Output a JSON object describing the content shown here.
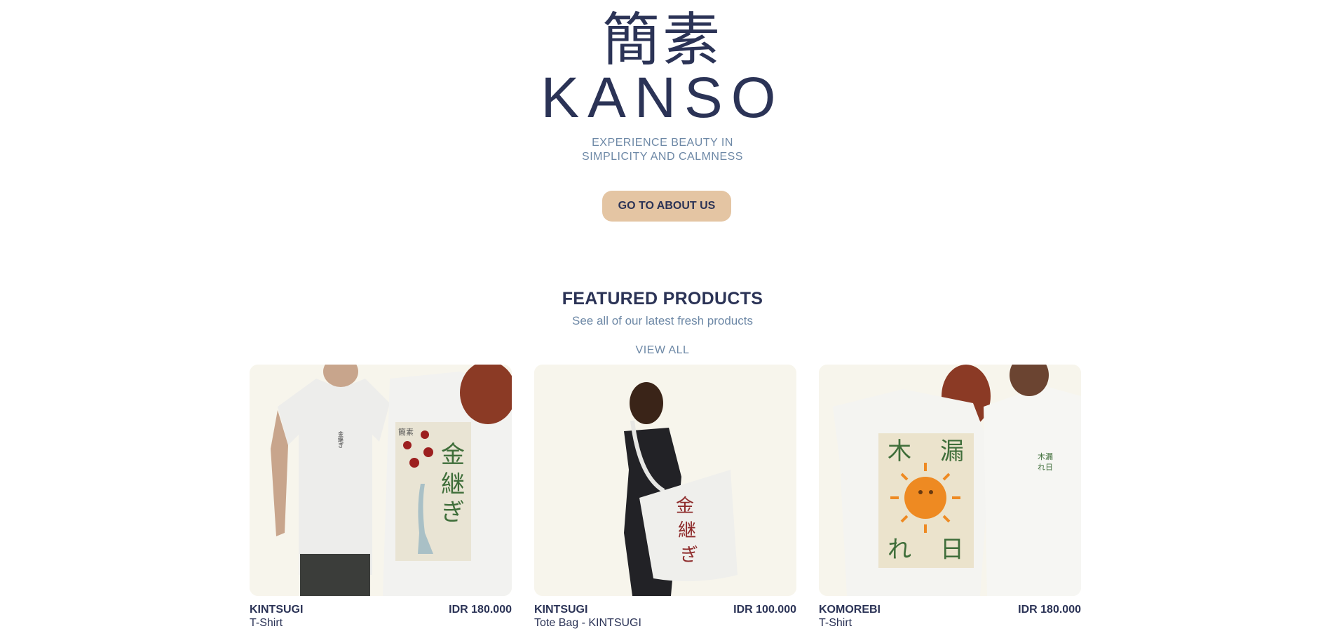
{
  "hero": {
    "logo_kanji": "簡素",
    "logo_latin": "KANSO",
    "tagline_line1": "EXPERIENCE BEAUTY IN",
    "tagline_line2": "SIMPLICITY AND CALMNESS",
    "cta_label": "GO TO ABOUT US"
  },
  "featured": {
    "title": "FEATURED PRODUCTS",
    "subtitle": "See all of our latest fresh products",
    "view_all": "VIEW ALL"
  },
  "products": [
    {
      "name": "KINTSUGI",
      "price": "IDR 180.000",
      "type": "T-Shirt",
      "image_icon": "kintsugi-tshirt-photo",
      "art_text": "金継ぎ"
    },
    {
      "name": "KINTSUGI",
      "price": "IDR 100.000",
      "type": "Tote Bag - KINTSUGI",
      "image_icon": "kintsugi-tote-bag-photo",
      "art_text": "金継ぎ"
    },
    {
      "name": "KOMOREBI",
      "price": "IDR 180.000",
      "type": "T-Shirt",
      "image_icon": "komorebi-tshirt-photo",
      "art_text": "木漏れ日"
    }
  ],
  "colors": {
    "navy": "#2b3356",
    "muted_blue": "#6d88a6",
    "cta_bg": "#e4c5a3",
    "card_bg": "#f7f5ec"
  }
}
